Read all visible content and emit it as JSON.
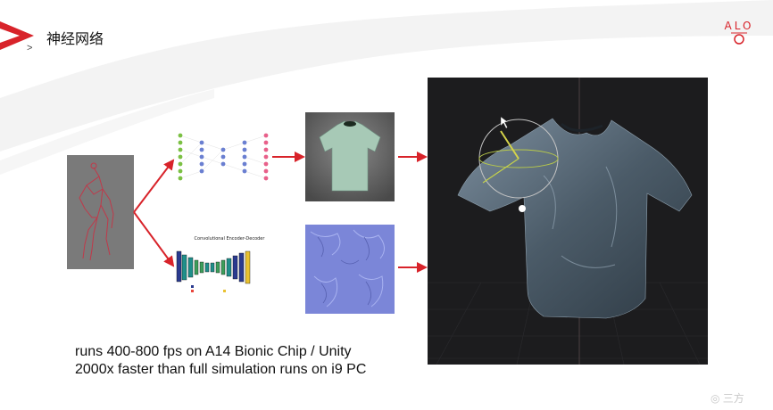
{
  "slide": {
    "title": "神经网络",
    "sub_marker": ">",
    "logo_text": "ALO",
    "captions": [
      "runs 400-800 fps on A14 Bionic Chip / Unity",
      "2000x faster than full simulation runs on i9 PC"
    ],
    "cnn_diagram_title": "Convolutional Encoder-Decoder",
    "watermark": "◎ 三方"
  },
  "colors": {
    "accent_red": "#d8232a",
    "viewport_bg": "#1c1c1e",
    "normal_map": "#7b86d8"
  }
}
